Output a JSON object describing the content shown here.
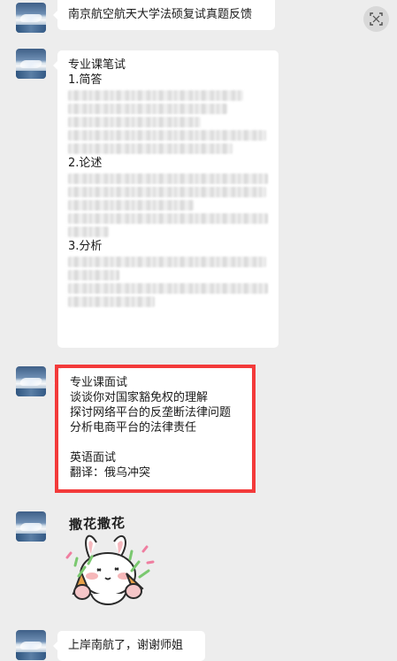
{
  "messages": [
    {
      "avatar": "user-avatar",
      "text": "南京航空航天大学法硕复试真题反馈"
    },
    {
      "avatar": "user-avatar",
      "heading": "专业课笔试",
      "section1": "1.简答",
      "section2": "2.论述",
      "section3": "3.分析",
      "blurred_note": "blurred text lines"
    },
    {
      "avatar": "user-avatar",
      "line1": "专业课面试",
      "line2": "谈谈你对国家豁免权的理解",
      "line3": "探讨网络平台的反垄断法律问题",
      "line4": "分析电商平台的法律责任",
      "line5": "英语面试",
      "line6": "翻译：俄乌冲突"
    },
    {
      "avatar": "user-avatar",
      "sticker_text": "撒花撒花"
    },
    {
      "avatar": "user-avatar",
      "text": "上岸南航了，谢谢师姐"
    }
  ],
  "icons": {
    "scan": "scan-icon"
  },
  "colors": {
    "background": "#ededed",
    "bubble": "#ffffff",
    "highlight": "#f33a3a"
  }
}
